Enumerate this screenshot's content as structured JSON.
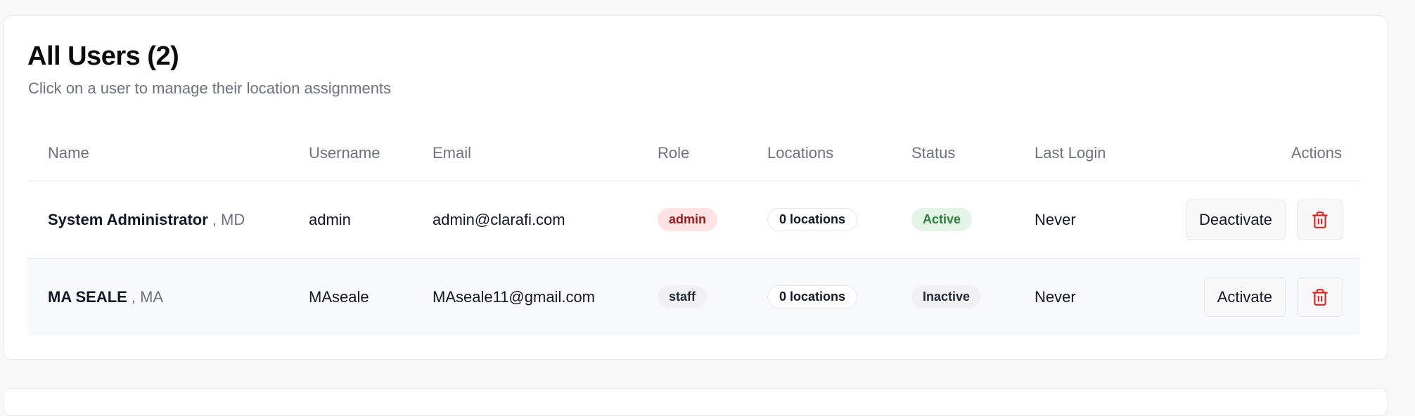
{
  "page": {
    "title": "All Users (2)",
    "subtitle": "Click on a user to manage their location assignments"
  },
  "table": {
    "headers": {
      "name": "Name",
      "username": "Username",
      "email": "Email",
      "role": "Role",
      "locations": "Locations",
      "status": "Status",
      "last_login": "Last Login",
      "actions": "Actions"
    },
    "rows": [
      {
        "name": "System Administrator",
        "credential": ", MD",
        "username": "admin",
        "email": "admin@clarafi.com",
        "role": "admin",
        "locations": "0 locations",
        "status": "Active",
        "last_login": "Never",
        "action_label": "Deactivate"
      },
      {
        "name": "MA SEALE",
        "credential": ", MA",
        "username": "MAseale",
        "email": "MAseale11@gmail.com",
        "role": "staff",
        "locations": "0 locations",
        "status": "Inactive",
        "last_login": "Never",
        "action_label": "Activate"
      }
    ]
  },
  "icons": {
    "delete": "trash-icon"
  },
  "colors": {
    "admin_badge_bg": "#fde3e3",
    "admin_badge_text": "#991b1b",
    "active_badge_bg": "#e3f5e6",
    "active_badge_text": "#2f7d3a",
    "delete_icon": "#dc2626"
  }
}
